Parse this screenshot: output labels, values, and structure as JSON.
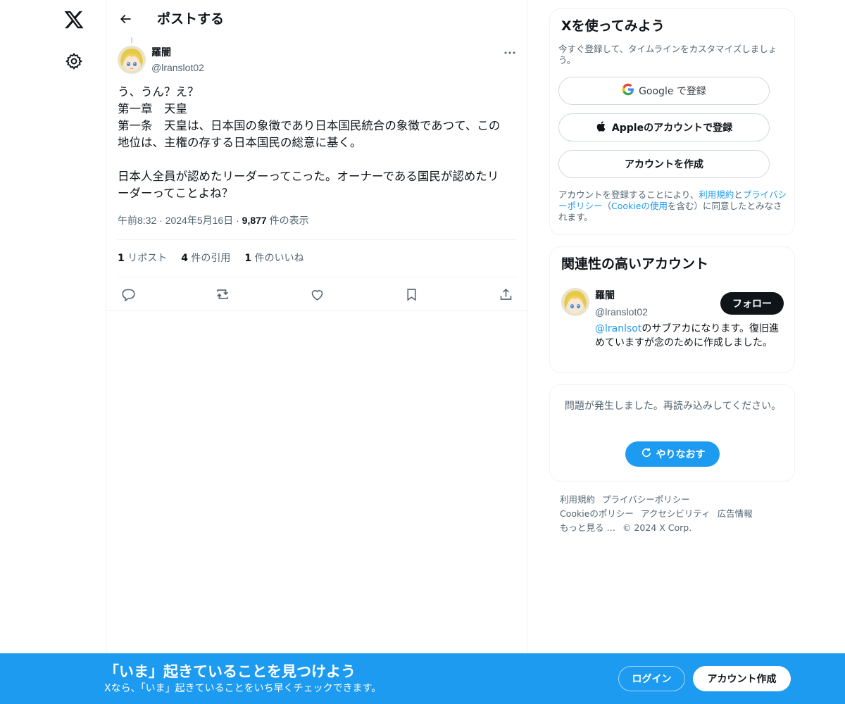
{
  "header": {
    "title": "ポストする"
  },
  "post": {
    "author_name": "羅闇",
    "author_handle": "@lranslot02",
    "text_lines": [
      "う、うん？え？",
      "第一章　天皇",
      "第一条　天皇は、日本国の象徴であり日本国民統合の象徴であつて、この",
      "地位は、主権の存する日本国民の総意に基く。",
      "",
      "日本人全員が認めたリーダーってこった。オーナーである国民が認めたリ",
      "ーダーってことよね？"
    ],
    "time": "午前8:32",
    "date": "2024年5月16日",
    "views": "9,877",
    "views_label": "件の表示",
    "reposts_count": "1",
    "reposts_label": "リポスト",
    "quotes_count": "4",
    "quotes_label": "件の引用",
    "likes_count": "1",
    "likes_label": "件のいいね"
  },
  "signup_card": {
    "title": "Xを使ってみよう",
    "subtitle": "今すぐ登録して、タイムラインをカスタマイズしましょう。",
    "google_label": "Google で登録",
    "apple_label": "Appleのアカウントで登録",
    "create_label": "アカウントを作成",
    "terms_prefix": "アカウントを登録することにより、",
    "terms_link": "利用規約",
    "terms_and": "と",
    "privacy_link": "プライバシーポリシー",
    "cookie_open": "（",
    "cookie_link": "Cookieの使用",
    "cookie_close": "を含む）に同意したとみなされます。"
  },
  "related": {
    "title": "関連性の高いアカウント",
    "name": "羅闇",
    "handle": "@lranslot02",
    "follow_label": "フォロー",
    "bio_mention": "@lranlsot",
    "bio_text": "のサブアカになります。復旧進めていますが念のために作成しました。"
  },
  "error_card": {
    "message": "問題が発生しました。再読み込みしてください。",
    "retry_label": "やりなおす"
  },
  "footer": {
    "links": [
      "利用規約",
      "プライバシーポリシー",
      "Cookieのポリシー",
      "アクセシビリティ",
      "広告情報",
      "もっと見る …",
      "© 2024 X Corp."
    ]
  },
  "banner": {
    "title": "「いま」起きていることを見つけよう",
    "subtitle": "Xなら、「いま」起きていることをいち早くチェックできます。",
    "login_label": "ログイン",
    "signup_label": "アカウント作成"
  },
  "colors": {
    "accent": "#1d9bf0",
    "text": "#0f1419",
    "muted": "#536471"
  },
  "icons": [
    "x-logo-icon",
    "gear-icon",
    "back-arrow-icon",
    "more-icon",
    "reply-icon",
    "repost-icon",
    "like-icon",
    "bookmark-icon",
    "share-icon",
    "google-icon",
    "apple-icon",
    "refresh-icon"
  ]
}
